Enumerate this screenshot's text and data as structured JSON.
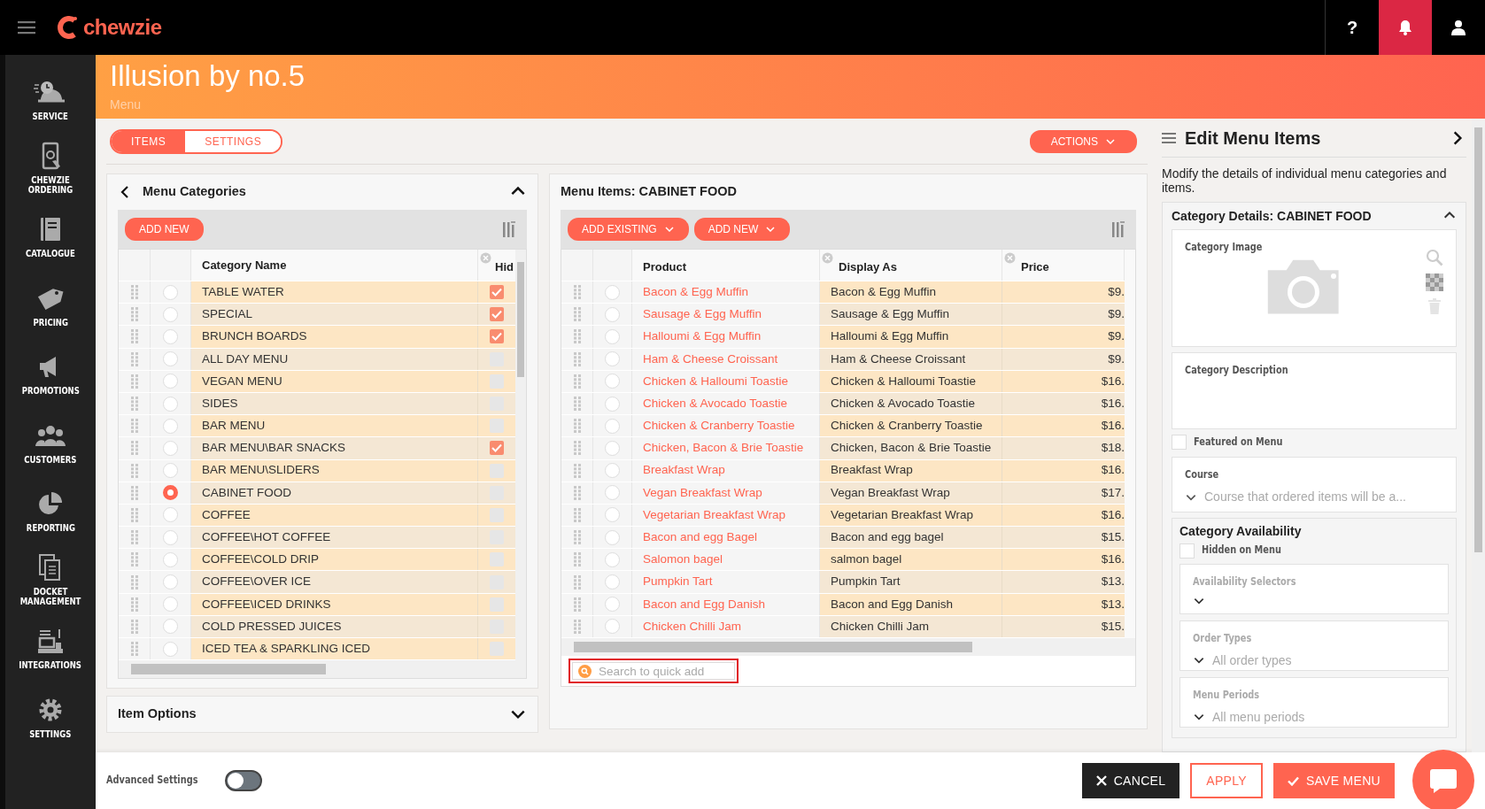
{
  "topbar": {
    "logo": "chewzie",
    "help": "?"
  },
  "sidebar": {
    "items": [
      {
        "label": "SERVICE"
      },
      {
        "label": "CHEWZIE ORDERING"
      },
      {
        "label": "CATALOGUE"
      },
      {
        "label": "PRICING"
      },
      {
        "label": "PROMOTIONS"
      },
      {
        "label": "CUSTOMERS"
      },
      {
        "label": "REPORTING"
      },
      {
        "label": "DOCKET MANAGEMENT"
      },
      {
        "label": "INTEGRATIONS"
      },
      {
        "label": "SETTINGS"
      }
    ]
  },
  "header": {
    "title": "Illusion by no.5",
    "subtitle": "Menu"
  },
  "tabs": [
    {
      "label": "ITEMS",
      "selected": true
    },
    {
      "label": "SETTINGS",
      "selected": false
    }
  ],
  "actions_button": "ACTIONS",
  "categories": {
    "title": "Menu Categories",
    "expanded": true,
    "add_button": "ADD NEW",
    "columns": [
      "Category Name",
      "Hid"
    ],
    "rows": [
      {
        "name": "TABLE WATER",
        "selected": false,
        "hidden": true
      },
      {
        "name": "SPECIAL",
        "selected": false,
        "hidden": true
      },
      {
        "name": "BRUNCH BOARDS",
        "selected": false,
        "hidden": true
      },
      {
        "name": "ALL DAY MENU",
        "selected": false,
        "hidden": false
      },
      {
        "name": "VEGAN MENU",
        "selected": false,
        "hidden": false
      },
      {
        "name": "SIDES",
        "selected": false,
        "hidden": false
      },
      {
        "name": "BAR MENU",
        "selected": false,
        "hidden": false
      },
      {
        "name": "BAR MENU\\BAR SNACKS",
        "selected": false,
        "hidden": true
      },
      {
        "name": "BAR MENU\\SLIDERS",
        "selected": false,
        "hidden": false
      },
      {
        "name": "CABINET FOOD",
        "selected": true,
        "hidden": false
      },
      {
        "name": "COFFEE",
        "selected": false,
        "hidden": false
      },
      {
        "name": "COFFEE\\HOT COFFEE",
        "selected": false,
        "hidden": false
      },
      {
        "name": "COFFEE\\COLD DRIP",
        "selected": false,
        "hidden": false
      },
      {
        "name": "COFFEE\\OVER ICE",
        "selected": false,
        "hidden": false
      },
      {
        "name": "COFFEE\\ICED DRINKS",
        "selected": false,
        "hidden": false
      },
      {
        "name": "COLD PRESSED JUICES",
        "selected": false,
        "hidden": false
      },
      {
        "name": "ICED TEA & SPARKLING ICED",
        "selected": false,
        "hidden": false
      }
    ]
  },
  "item_options": {
    "title": "Item Options",
    "expanded": false
  },
  "menu_items": {
    "title": "Menu Items: CABINET FOOD",
    "buttons": [
      "ADD EXISTING",
      "ADD NEW"
    ],
    "columns": [
      "Product",
      "Display As",
      "Price"
    ],
    "rows": [
      {
        "product": "Bacon & Egg Muffin",
        "display": "Bacon & Egg Muffin",
        "price": "$9.",
        "selected": false
      },
      {
        "product": "Sausage & Egg Muffin",
        "display": "Sausage & Egg Muffin",
        "price": "$9.",
        "selected": false
      },
      {
        "product": "Halloumi & Egg Muffin",
        "display": "Halloumi & Egg Muffin",
        "price": "$9.",
        "selected": false
      },
      {
        "product": "Ham & Cheese Croissant",
        "display": "Ham & Cheese Croissant",
        "price": "$9.",
        "selected": false
      },
      {
        "product": "Chicken & Halloumi Toastie",
        "display": "Chicken & Halloumi Toastie",
        "price": "$16.",
        "selected": false
      },
      {
        "product": "Chicken & Avocado Toastie",
        "display": "Chicken & Avocado Toastie",
        "price": "$16.",
        "selected": false
      },
      {
        "product": "Chicken & Cranberry Toastie",
        "display": "Chicken & Cranberry Toastie",
        "price": "$16.",
        "selected": false
      },
      {
        "product": "Chicken, Bacon & Brie Toastie",
        "display": "Chicken, Bacon & Brie Toastie",
        "price": "$18.",
        "selected": false
      },
      {
        "product": "Breakfast Wrap",
        "display": "Breakfast Wrap",
        "price": "$16.",
        "selected": false
      },
      {
        "product": "Vegan Breakfast Wrap",
        "display": "Vegan Breakfast Wrap",
        "price": "$17.",
        "selected": false
      },
      {
        "product": "Vegetarian Breakfast Wrap",
        "display": "Vegetarian Breakfast Wrap",
        "price": "$16.",
        "selected": false
      },
      {
        "product": "Bacon and egg Bagel",
        "display": "Bacon and egg bagel",
        "price": "$15.",
        "selected": false
      },
      {
        "product": "Salomon bagel",
        "display": "salmon bagel",
        "price": "$16.",
        "selected": false
      },
      {
        "product": "Pumpkin Tart",
        "display": "Pumpkin Tart",
        "price": "$13.",
        "selected": false
      },
      {
        "product": "Bacon and Egg Danish",
        "display": "Bacon and Egg Danish",
        "price": "$13.",
        "selected": false
      },
      {
        "product": "Chicken Chilli Jam",
        "display": "Chicken Chilli Jam",
        "price": "$15.",
        "selected": false
      }
    ],
    "search": {
      "placeholder": "Search to quick add",
      "highlighted": true
    }
  },
  "edit_panel": {
    "title": "Edit Menu Items",
    "description": "Modify the details of individual menu categories and items.",
    "details": {
      "title": "Category Details: CABINET FOOD",
      "expanded": true,
      "image_label": "Category Image",
      "description_label": "Category Description",
      "featured": {
        "label": "Featured on Menu",
        "checked": false
      },
      "course": {
        "label": "Course",
        "placeholder": "Course that ordered items will be a..."
      }
    },
    "availability": {
      "title": "Category Availability",
      "hidden": {
        "label": "Hidden on Menu",
        "checked": false
      },
      "selectors": [
        {
          "label": "Availability Selectors"
        },
        {
          "label": "Order Types",
          "placeholder": "All order types"
        },
        {
          "label": "Menu Periods",
          "placeholder": "All menu periods"
        }
      ]
    }
  },
  "footer": {
    "advanced": {
      "label": "Advanced Settings",
      "on": false
    },
    "buttons": [
      {
        "label": "CANCEL",
        "kind": "cancel"
      },
      {
        "label": "APPLY",
        "kind": "apply"
      },
      {
        "label": "SAVE MENU",
        "kind": "save"
      }
    ]
  }
}
